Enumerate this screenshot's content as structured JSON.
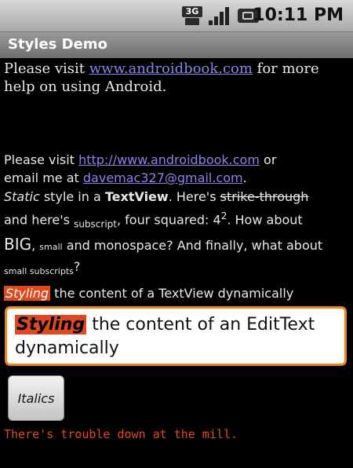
{
  "status_bar": {
    "time": "10:11 PM",
    "network_label": "3G",
    "icons": [
      "network-3g-icon",
      "signal-icon",
      "battery-icon"
    ]
  },
  "app": {
    "title": "Styles Demo"
  },
  "para1": {
    "prefix": "Please visit ",
    "link": "www.androidbook.com",
    "suffix": " for more help on using Android."
  },
  "para2": {
    "line1_prefix": "Please visit ",
    "link1": "http://www.androidbook.com",
    "line1_suffix": " or",
    "line2_prefix": "email me at ",
    "link2": "davemac327@gmail.com",
    "line2_suffix": "."
  },
  "para3": {
    "static_word": "Static",
    "text_a": " style in a ",
    "textview": "TextView",
    "text_b": ". Here's ",
    "strike": "strike-through",
    "text_c": " and here's ",
    "subscript": "subscript",
    "text_d": ", four squared: 4",
    "sup": "2",
    "text_e": ". How about ",
    "big": "BIG",
    "text_f": ", ",
    "small": "small",
    "text_g": " and ",
    "mono": "monospace",
    "text_h": "? And finally, what about ",
    "small_sub": "small subscripts",
    "text_i": "?"
  },
  "dynamic_textview": {
    "styled_word": "Styling",
    "rest": " the content of a TextView dynamically"
  },
  "edit_text": {
    "styled_word": "Styling",
    "rest": " the content of an EditText dynamically"
  },
  "italics_button": {
    "label": "Italics"
  },
  "message": "There's trouble down at the mill.",
  "colors": {
    "accent": "#e0491e",
    "link": "#8a84e8",
    "focus": "#f08020"
  }
}
